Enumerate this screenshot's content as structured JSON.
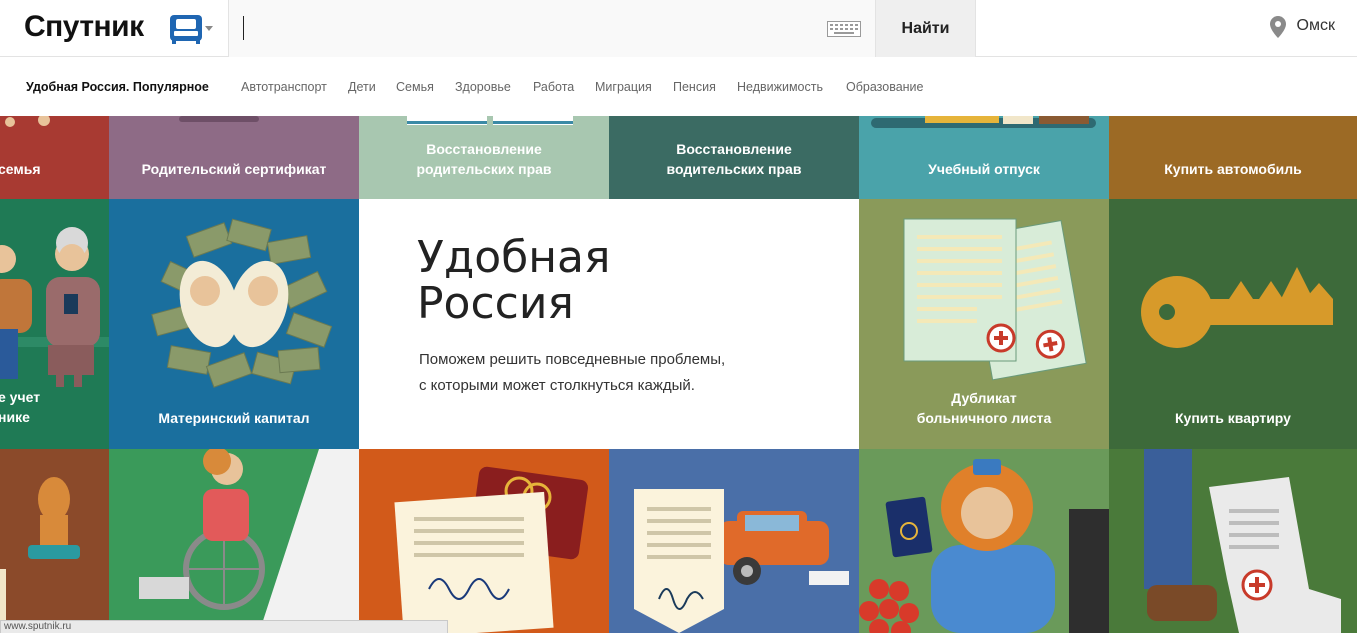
{
  "header": {
    "logo_text": "Спутник",
    "logo_icon": "sofa-icon",
    "search_value": "",
    "keyboard_icon": "keyboard-icon",
    "find_label": "Найти",
    "city": "Омск",
    "location_icon": "map-pin-icon"
  },
  "nav": {
    "items": [
      {
        "label": "Удобная Россия. Популярное",
        "active": true
      },
      {
        "label": "Автотранспорт"
      },
      {
        "label": "Дети"
      },
      {
        "label": "Семья"
      },
      {
        "label": "Здоровье"
      },
      {
        "label": "Работа"
      },
      {
        "label": "Миграция"
      },
      {
        "label": "Пенсия"
      },
      {
        "label": "Недвижимость"
      },
      {
        "label": "Образование"
      }
    ]
  },
  "tiles": {
    "row1": [
      {
        "label": "семья",
        "color": "#a83a32"
      },
      {
        "label": "Родительский сертификат",
        "color": "#8e6b86"
      },
      {
        "label": "Восстановление\nродительских прав",
        "color": "#a8c7b0"
      },
      {
        "label": "Восстановление\nводительских прав",
        "color": "#3b6b63"
      },
      {
        "label": "Учебный отпуск",
        "color": "#4aa3aa"
      },
      {
        "label": "Купить автомобиль",
        "color": "#9c6a25"
      }
    ],
    "row2": [
      {
        "label": "е учет\nнике",
        "color": "#1f7a55"
      },
      {
        "label": "Материнский капитал",
        "color": "#1a6f9e"
      },
      {
        "label": "Дубликат\nбольничного листа",
        "color": "#8a9a5a"
      },
      {
        "label": "Купить квартиру",
        "color": "#3d6a3a"
      }
    ],
    "row3_colors": [
      "#8b4a2a",
      "#3a9a5a",
      "#d25a1a",
      "#4a6fa8",
      "#6a9a5a",
      "#4a7a3a"
    ]
  },
  "promo": {
    "title": "Удобная\nРоссия",
    "text": "Поможем решить повседневные проблемы,\nс которыми может столкнуться каждый."
  },
  "statusbar": {
    "url": "www.sputnik.ru"
  }
}
